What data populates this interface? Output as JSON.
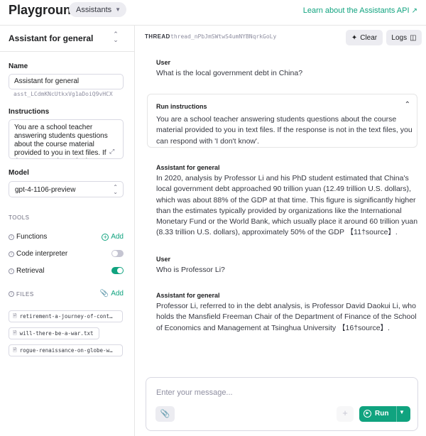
{
  "header": {
    "brand": "Playground",
    "mode_pill": "Assistants",
    "learn_link": "Learn about the Assistants API"
  },
  "sidebar": {
    "assistant_selector": "Assistant for general",
    "name_label": "Name",
    "name_value": "Assistant for general",
    "assistant_id": "asst_LCdmKNcUtkxVg1aDoiQ9vHCX",
    "instructions_label": "Instructions",
    "instructions_value": "You are a school teacher answering students questions about the course material provided to you in text files. If the  response is not in the text files, you can respond with 'I don't know'.",
    "model_label": "Model",
    "model_value": "gpt-4-1106-preview",
    "tools_label": "TOOLS",
    "tools": {
      "functions": "Functions",
      "functions_add": "Add",
      "code_interpreter": "Code interpreter",
      "code_interpreter_on": false,
      "retrieval": "Retrieval",
      "retrieval_on": true
    },
    "files_label": "FILES",
    "files_add": "Add",
    "files": [
      "retirement-a-journey-of-cont…",
      "will-there-be-a-war.txt",
      "rogue-renaissance-on-globe-w…"
    ]
  },
  "thread": {
    "label": "THREAD",
    "id": "thread_nPbJmSWtwS4umNYBNqrkGoLy",
    "clear_label": "Clear",
    "logs_label": "Logs"
  },
  "messages": [
    {
      "role": "User",
      "text": "What is the local government debt in China?"
    },
    {
      "role": "Assistant for general",
      "text": "In 2020, analysis by Professor Li and his PhD student estimated that China's local government debt approached 90 trillion yuan (12.49 trillion U.S. dollars), which was about 88% of the GDP at that time. This figure is significantly higher than the estimates typically provided by organizations like the International Monetary Fund or the World Bank, which usually place it around 60 trillion yuan (8.33 trillion U.S. dollars), approximately 50% of the GDP 【11†source】."
    },
    {
      "role": "User",
      "text": "Who is Professor Li?"
    },
    {
      "role": "Assistant for general",
      "text": "Professor Li, referred to in the debt analysis, is Professor David Daokui Li, who holds the Mansfield Freeman Chair of the Department of Finance of the School of Economics and Management at Tsinghua University 【16†source】."
    }
  ],
  "run_instructions": {
    "title": "Run instructions",
    "text": "You are a school teacher answering students questions about the course material provided to you in text files. If the response is not in the text files, you can respond with 'I don't know'."
  },
  "composer": {
    "placeholder": "Enter your message...",
    "run_label": "Run"
  },
  "colors": {
    "accent": "#10a37f",
    "border": "#e5e5e5",
    "button_bg": "#ececf1"
  },
  "icons": [
    "chevron-down-icon",
    "external-link-icon",
    "up-down-icon",
    "resize-icon",
    "info-icon",
    "plus-circle-icon",
    "paperclip-icon",
    "document-icon",
    "broom-icon",
    "sidebar-icon",
    "chevron-up-icon",
    "play-icon",
    "plus-icon",
    "caret-down-icon"
  ]
}
